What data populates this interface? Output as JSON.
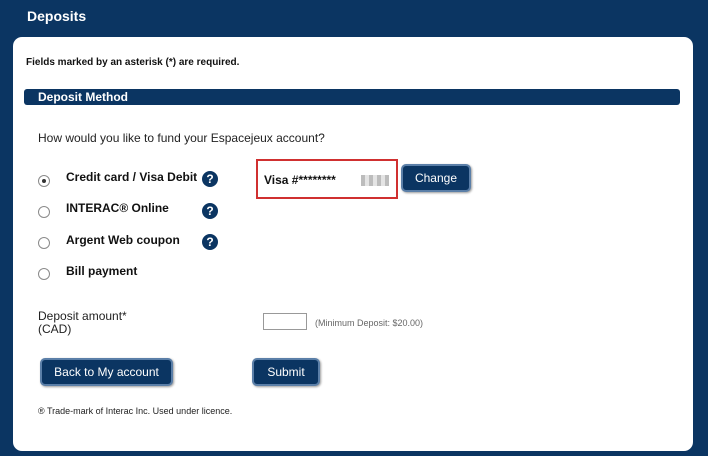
{
  "header": {
    "title": "Deposits"
  },
  "form": {
    "required_note": "Fields marked by an asterisk (*) are required.",
    "section_title": "Deposit Method",
    "question": "How would you like to fund your Espacejeux account?",
    "options": [
      {
        "label": "Credit card / Visa Debit",
        "selected": true,
        "help": "?"
      },
      {
        "label": "INTERAC® Online",
        "selected": false,
        "help": "?"
      },
      {
        "label": "Argent Web coupon",
        "selected": false,
        "help": "?"
      },
      {
        "label": "Bill payment",
        "selected": false
      }
    ],
    "card": {
      "masked_number": "Visa #********",
      "change_label": "Change"
    },
    "amount": {
      "label_line1": "Deposit amount*",
      "label_line2": "(CAD)",
      "value": "",
      "min_note": "(Minimum Deposit: $20.00)"
    },
    "buttons": {
      "back_label": "Back to My account",
      "submit_label": "Submit"
    },
    "footnote": "® Trade-mark of Interac Inc. Used under licence."
  },
  "colors": {
    "brand_navy": "#0b3562",
    "highlight_red": "#d03030"
  },
  "icons": {
    "help": "question-circle-icon"
  }
}
